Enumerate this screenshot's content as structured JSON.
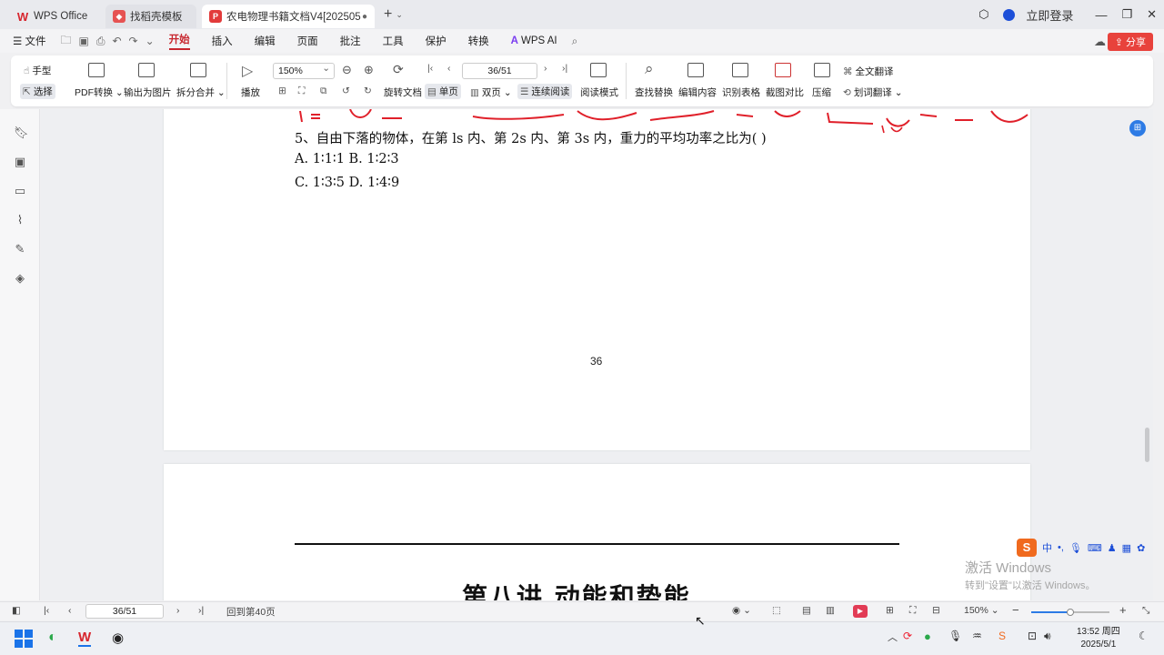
{
  "tabs": [
    {
      "label": "WPS Office"
    },
    {
      "label": "找稻壳模板"
    },
    {
      "label": "农电物理书籍文档V4[202505"
    }
  ],
  "titlebar": {
    "login": "立即登录"
  },
  "menu": {
    "items": [
      "文件",
      "开始",
      "插入",
      "编辑",
      "页面",
      "批注",
      "工具",
      "保护",
      "转换",
      "WPS AI"
    ],
    "share": "分享"
  },
  "ribbon": {
    "hand": "手型",
    "select": "选择",
    "pdf_convert": "PDF转换",
    "export_image": "输出为图片",
    "split_merge": "拆分合并",
    "play": "播放",
    "zoom": "150%",
    "page": "36/51",
    "rotate": "旋转文档",
    "single": "单页",
    "double": "双页",
    "continuous": "连续阅读",
    "read_mode": "阅读模式",
    "find_replace": "查找替换",
    "edit_content": "编辑内容",
    "recognize_table": "识别表格",
    "screenshot_compare": "截图对比",
    "compress": "压缩",
    "full_translate": "全文翻译",
    "line_translate": "划词翻译"
  },
  "document": {
    "question": "5、自由下落的物体，在第 ls 内、第 2s 内、第 3s 内，重力的平均功率之比为( )",
    "option_ab": "A.  1∶1∶1   B.  1∶2∶3",
    "option_cd": "C.  1∶3∶5   D.  1∶4∶9",
    "page_number": "36",
    "chapter_title": "第八讲  动能和势能"
  },
  "statusbar": {
    "page": "36/51",
    "goto": "回到第40页",
    "zoom": "150%",
    "zoom_level": 0.5
  },
  "watermark": {
    "line1": "激活 Windows",
    "line2": "转到\"设置\"以激活 Windows。"
  },
  "ime": {
    "mode": "中"
  },
  "clock": {
    "time": "13:52 周四",
    "date": "2025/5/1"
  },
  "colors": {
    "accent": "#c7262e",
    "link": "#1d4fd8",
    "ink": "#e0202a"
  }
}
